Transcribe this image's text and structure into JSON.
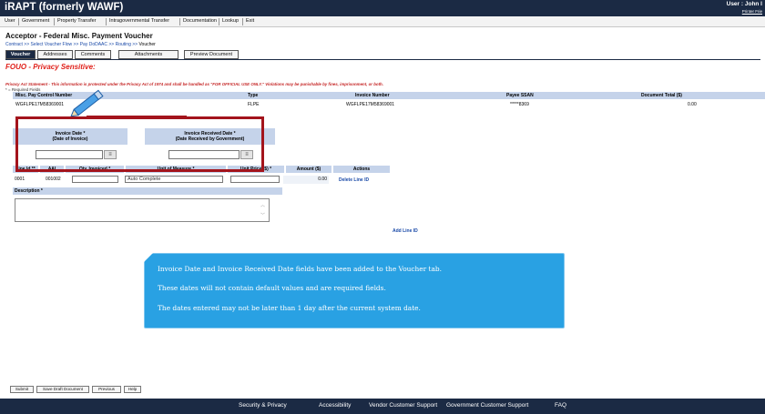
{
  "header": {
    "title": "iRAPT (formerly WAWF)",
    "user": "User : John I",
    "user_link": "Printer Frie"
  },
  "menu": [
    "User",
    "Government",
    "Property Transfer",
    "Intragovernmental Transfer",
    "Documentation",
    "Lookup",
    "Exit"
  ],
  "page_title": "Acceptor - Federal Misc. Payment Voucher",
  "breadcrumb": {
    "links": "Contract >> Select Voucher Flow >> Pay DoDAAC >> Routing >>",
    "current": " Voucher"
  },
  "tabs": [
    "Voucher",
    "Addresses",
    "Comments",
    "Attachments",
    "Preview Document"
  ],
  "fouo_title": "FOUO - Privacy Sensitive:",
  "privacy_text": "Privacy Act Statement - This information is protected under the Privacy Act of 1974 and shall be handled as \"FOR OFFICIAL USE ONLY.\" Violations may be punishable by fines, imprisonment, or both.",
  "required_note": "* = Required Fields",
  "doc_grid": {
    "headers": [
      "Misc. Pay Control Number",
      "Type",
      "Invoice Number",
      "Payee SSAN",
      "Document Total ($)"
    ],
    "row": [
      "WGFLPE17M58369001",
      "FLPE",
      "WGFLPE17M58369001",
      "*****8369",
      "0.00"
    ]
  },
  "invoice_date": {
    "label1": "Invoice Date *",
    "label2": "(Date of Invoice)",
    "value": ""
  },
  "received_date": {
    "label1": "Invoice Received Date *",
    "label2": "(Date Received by Government)",
    "value": ""
  },
  "line_grid": {
    "headers": [
      "Line Id.**",
      "AAI",
      "Qty. Invoiced *",
      "Unit of Measure *",
      "Unit Price ($) *",
      "Amount ($)",
      "Actions"
    ],
    "row": {
      "line_id": "0001",
      "aai": "001002",
      "qty": "",
      "uom": "Auto Complete",
      "unit_price": "",
      "amount": "0.00",
      "action": "Delete Line ID"
    }
  },
  "description_label": "Description *",
  "add_line_label": "Add Line ID",
  "callout": {
    "lines": [
      "Invoice Date and Invoice Received Date fields have been added to the Voucher tab.",
      "These dates will not contain default values and are required fields.",
      "The dates entered may not be later than 1 day after the current system date."
    ]
  },
  "bottom_buttons": [
    "Submit",
    "Save Draft Document",
    "Previous",
    "Help"
  ],
  "footer_links": [
    "Security & Privacy",
    "Accessibility",
    "Vendor Customer Support",
    "Government Customer Support",
    "FAQ"
  ],
  "colors": {
    "header_bg": "#1b2a44",
    "grid_header_bg": "#c5d3ea",
    "highlight_red": "#a3141c",
    "callout_bg": "#29a1e3",
    "fouo_red": "#e0201a"
  },
  "icons": [
    "calendar-icon",
    "pencil-icon",
    "scroll-up-icon",
    "scroll-down-icon"
  ]
}
